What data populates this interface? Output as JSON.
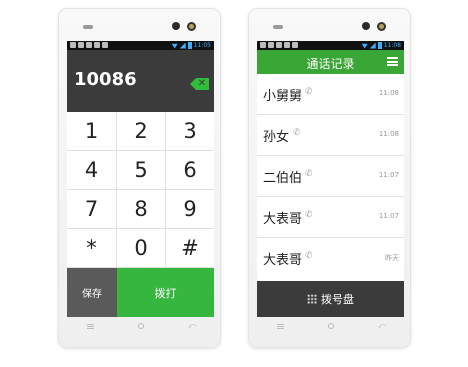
{
  "dialer": {
    "number": "10086",
    "keys": [
      "1",
      "2",
      "3",
      "4",
      "5",
      "6",
      "7",
      "8",
      "9",
      "*",
      "0",
      "#"
    ],
    "save_label": "保存",
    "call_label": "拨打",
    "status_time": "11:05",
    "accent_color": "#36b53f"
  },
  "call_log": {
    "title": "通话记录",
    "status_time": "11:08",
    "entries": [
      {
        "name": "小舅舅",
        "time": "11:08"
      },
      {
        "name": "孙女",
        "time": "11:08"
      },
      {
        "name": "二伯伯",
        "time": "11:07"
      },
      {
        "name": "大表哥",
        "time": "11:07"
      },
      {
        "name": "大表哥",
        "time": "昨天"
      }
    ],
    "dialpad_label": "拨号盘",
    "header_color": "#3aa635"
  }
}
